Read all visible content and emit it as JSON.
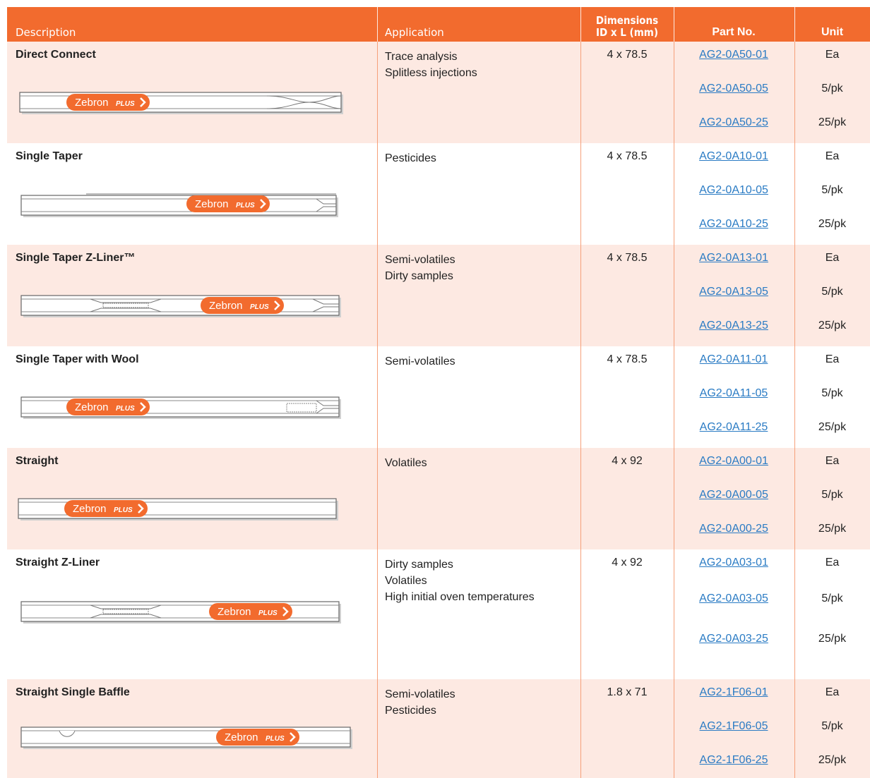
{
  "header": {
    "description": "Description",
    "application": "Application",
    "dimensions_line1": "Dimensions",
    "dimensions_line2": "ID x L (mm)",
    "part_no": "Part No.",
    "unit": "Unit"
  },
  "badge_text": "Zebron",
  "badge_sub": "PLUS",
  "colors": {
    "accent": "#f26b2e",
    "shade": "#fde9e2",
    "link": "#2a7bc4"
  },
  "rows": [
    {
      "name": "Direct Connect",
      "apps": [
        "Trace analysis",
        "Splitless injections"
      ],
      "dims": "4 x 78.5",
      "parts": [
        "AG2-0A50-01",
        "AG2-0A50-05",
        "AG2-0A50-25"
      ],
      "units": [
        "Ea",
        "5/pk",
        "25/pk"
      ]
    },
    {
      "name": "Single Taper",
      "apps": [
        "Pesticides"
      ],
      "dims": "4 x 78.5",
      "parts": [
        "AG2-0A10-01",
        "AG2-0A10-05",
        "AG2-0A10-25"
      ],
      "units": [
        "Ea",
        "5/pk",
        "25/pk"
      ]
    },
    {
      "name": "Single Taper Z-Liner™",
      "apps": [
        "Semi-volatiles",
        "Dirty samples"
      ],
      "dims": "4 x 78.5",
      "parts": [
        "AG2-0A13-01",
        "AG2-0A13-05",
        "AG2-0A13-25"
      ],
      "units": [
        "Ea",
        "5/pk",
        "25/pk"
      ]
    },
    {
      "name": "Single Taper with Wool",
      "apps": [
        "Semi-volatiles"
      ],
      "dims": "4 x 78.5",
      "parts": [
        "AG2-0A11-01",
        "AG2-0A11-05",
        "AG2-0A11-25"
      ],
      "units": [
        "Ea",
        "5/pk",
        "25/pk"
      ]
    },
    {
      "name": "Straight",
      "apps": [
        "Volatiles"
      ],
      "dims": "4 x 92",
      "parts": [
        "AG2-0A00-01",
        "AG2-0A00-05",
        "AG2-0A00-25"
      ],
      "units": [
        "Ea",
        "5/pk",
        "25/pk"
      ]
    },
    {
      "name": "Straight  Z-Liner",
      "apps": [
        "Dirty samples",
        "Volatiles",
        "High initial oven temperatures"
      ],
      "dims": "4 x 92",
      "parts": [
        "AG2-0A03-01",
        "AG2-0A03-05",
        "AG2-0A03-25"
      ],
      "units": [
        "Ea",
        "5/pk",
        "25/pk"
      ]
    },
    {
      "name": "Straight  Single Baffle",
      "apps": [
        "Semi-volatiles",
        "Pesticides"
      ],
      "dims": "1.8 x 71",
      "parts": [
        "AG2-1F06-01",
        "AG2-1F06-05",
        "AG2-1F06-25"
      ],
      "units": [
        "Ea",
        "5/pk",
        "25/pk"
      ]
    }
  ]
}
